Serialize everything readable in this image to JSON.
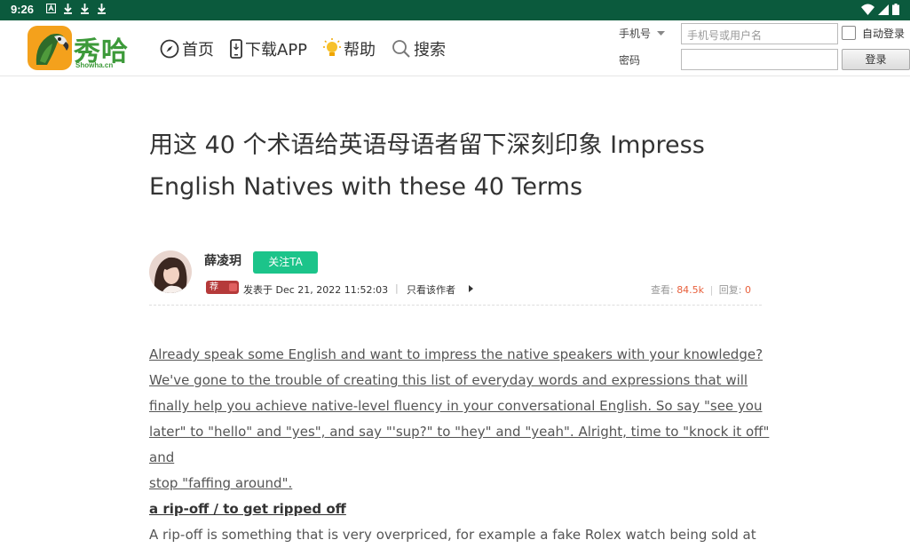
{
  "status_bar": {
    "time": "9:26",
    "left_icons": [
      "a-app-icon",
      "download-icon",
      "download-icon",
      "download-icon"
    ],
    "right_icons": [
      "wifi-icon",
      "signal-icon",
      "battery-icon"
    ]
  },
  "header": {
    "logo_text": "秀哈",
    "logo_sub": "Showha.cn",
    "nav": [
      {
        "label": "首页",
        "icon": "compass-icon"
      },
      {
        "label": "下载APP",
        "icon": "phone-icon"
      },
      {
        "label": "帮助",
        "icon": "bulb-icon"
      },
      {
        "label": "搜索",
        "icon": "search-icon"
      }
    ],
    "login": {
      "phone_label": "手机号",
      "phone_placeholder": "手机号或用户名",
      "password_label": "密码",
      "auto_login_label": "自动登录",
      "login_button": "登录"
    }
  },
  "article": {
    "title": "用这 40 个术语给英语母语者留下深刻印象 Impress English Natives with these 40 Terms",
    "author": "薛凌玥",
    "follow_label": "关注TA",
    "recommend_badge": "荐",
    "posted": "发表于 Dec 21, 2022 11:52:03",
    "separator": "|",
    "only_author": "只看该作者",
    "views_label": "查看:",
    "views": "84.5k",
    "replies_label": "回复:",
    "replies": "0",
    "intro_lines": [
      "Already speak some English and want to impress the native speakers with your knowledge?",
      "We've gone to the trouble of creating this list of everyday words and expressions that will",
      "finally help you achieve native-level fluency in your conversational English. So say \"see you",
      "later\" to \"hello\" and \"yes\", and say \"'sup?\" to \"hey\" and \"yeah\". Alright, time to \"knock it off\" and",
      "stop \"faffing around\"."
    ],
    "term": "a rip-off / to get ripped off",
    "body_line": "A rip-off is something that is very overpriced, for example a fake Rolex watch being sold at"
  }
}
